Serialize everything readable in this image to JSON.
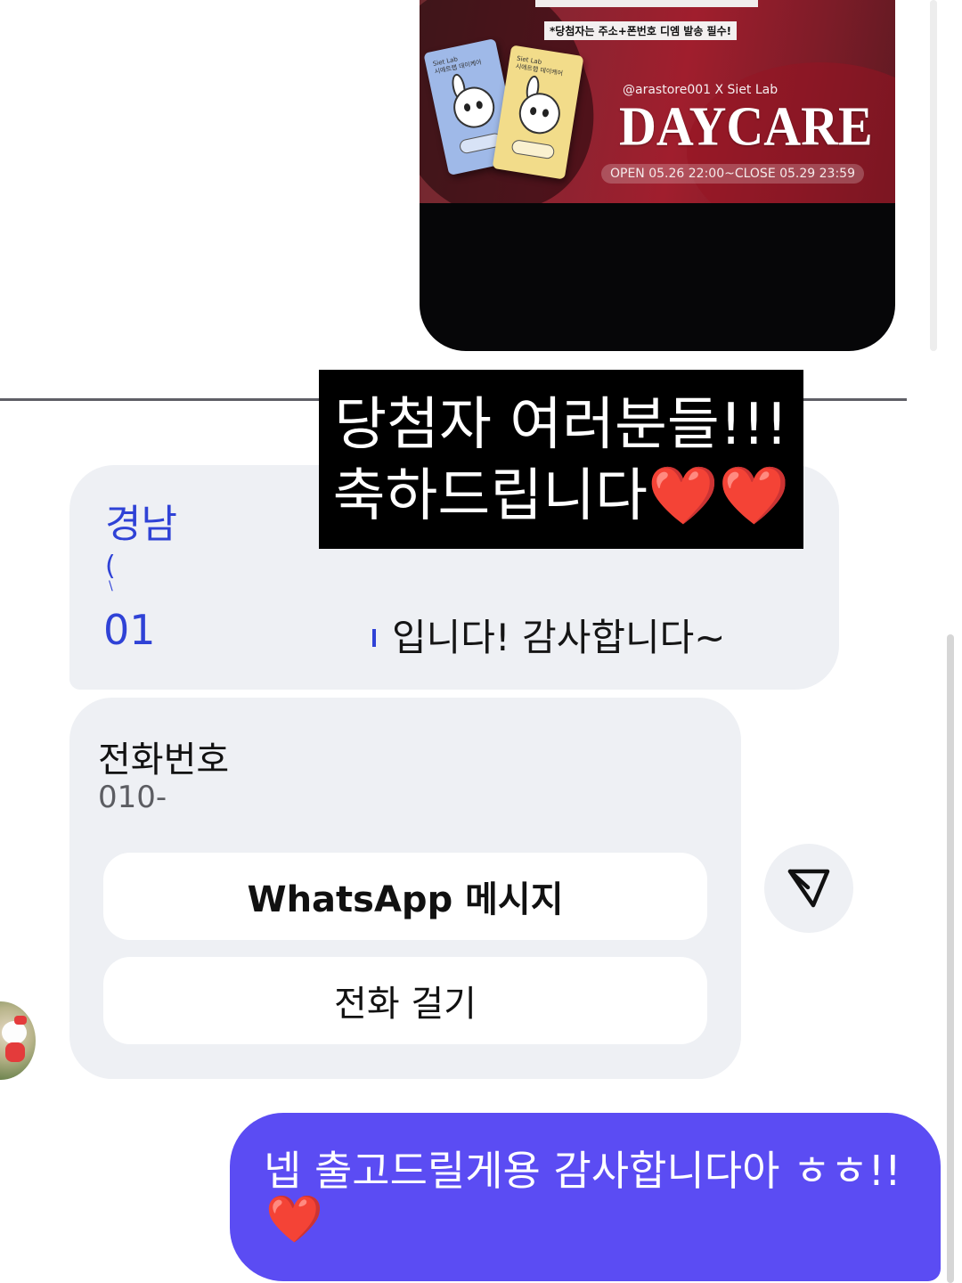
{
  "shared_post": {
    "notice": "*당첨자는 주소+폰번호 디엠 발송 필수!",
    "pack_text": "Siet Lab\n시에트랩 데이케어",
    "handle": "@arastore001 X Siet Lab",
    "title": "DAYCARE",
    "schedule": "OPEN 05.26 22:00~CLOSE 05.29 23:59"
  },
  "overlay_caption": {
    "line1": "당첨자 여러분들!!!",
    "line2": "축하드립니다",
    "hearts": "❤️❤️"
  },
  "received_message": {
    "region": "경남",
    "fragment_1": "(",
    "fragment_2": "\\",
    "number_fragment": "01",
    "tail": "입니다! 감사합니다~"
  },
  "contact_card": {
    "label": "전화번호",
    "value": "010-",
    "whatsapp_button": "WhatsApp 메시지",
    "call_button": "전화 걸기"
  },
  "sent_message": {
    "text": "넵 출고드릴게용 감사합니다아 ㅎㅎ!!",
    "emoji": "❤️"
  },
  "colors": {
    "sent_bubble": "#5b4cf3",
    "received_bubble": "#eef0f4",
    "link_blue": "#2f42d6",
    "promo_red": "#a01e2d"
  },
  "icons": {
    "share": "paper-plane-icon",
    "avatar": "hello-kitty-avatar"
  }
}
